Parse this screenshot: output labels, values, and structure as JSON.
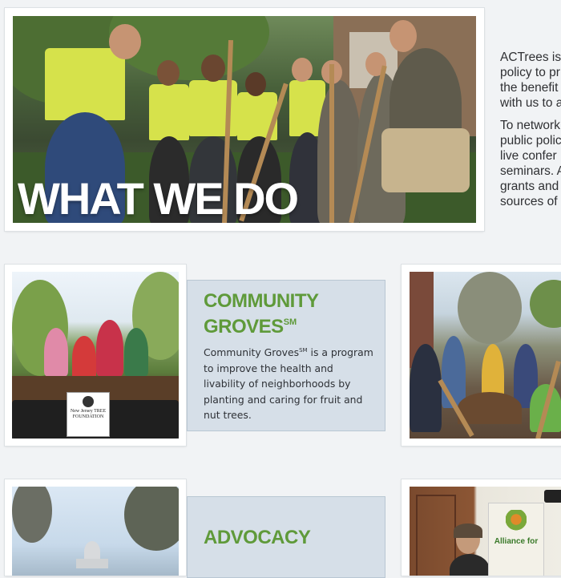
{
  "hero": {
    "title": "WHAT WE DO"
  },
  "intro": {
    "paragraph_1_lines": [
      "ACTrees is",
      "policy to pr",
      "the benefit",
      "with us to a"
    ],
    "paragraph_2_lines": [
      "To network",
      "public polic",
      "live confer",
      "seminars. A",
      "grants and",
      "sources of"
    ]
  },
  "community_groves": {
    "title_line1": "COMMUNITY",
    "title_line2": "GROVES",
    "title_mark": "SM",
    "desc_before_mark": "Community Groves",
    "desc_mark": "SM",
    "desc_after_mark": " is a program to improve the health and livability of neighborhoods by planting and caring for fruit and nut trees.",
    "sign_lines": [
      "New",
      "Jersey",
      "TREE",
      "FOUNDATION"
    ]
  },
  "advocacy": {
    "title": "ADVOCACY"
  },
  "office_banner": {
    "text": "Alliance for"
  },
  "colors": {
    "accent_green": "#5f9a3a",
    "panel_blue": "#d6dfe8",
    "page_bg": "#f1f3f5"
  }
}
